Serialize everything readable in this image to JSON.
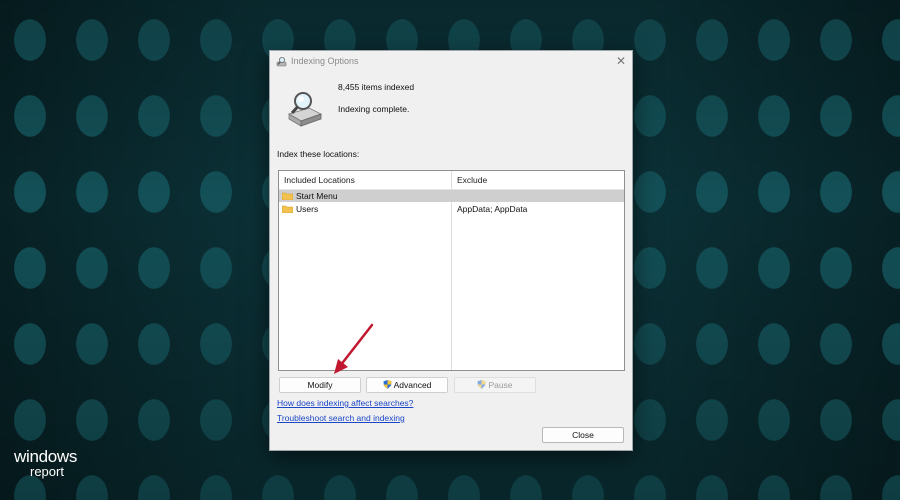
{
  "window": {
    "title": "Indexing Options"
  },
  "summary": {
    "items_indexed": "8,455 items indexed",
    "status": "Indexing complete."
  },
  "locations": {
    "label": "Index these locations:",
    "columns": [
      "Included Locations",
      "Exclude"
    ],
    "rows": [
      {
        "name": "Start Menu",
        "exclude": "",
        "selected": true
      },
      {
        "name": "Users",
        "exclude": "AppData; AppData",
        "selected": false
      }
    ]
  },
  "buttons": {
    "modify": "Modify",
    "advanced": "Advanced",
    "pause": "Pause",
    "close": "Close"
  },
  "links": {
    "help": "How does indexing affect searches?",
    "troubleshoot": "Troubleshoot search and indexing"
  },
  "logo": {
    "line1": "windows",
    "line2": "report"
  },
  "icons": {
    "window": "indexing-options-icon",
    "close": "close-icon",
    "folder": "folder-icon",
    "shield": "uac-shield-icon",
    "arrow": "red-arrow-annotation"
  },
  "colors": {
    "link": "#1a46c7",
    "arrow": "#c0182f",
    "desktop": "#0b3238",
    "folder": "#f2c14e"
  }
}
